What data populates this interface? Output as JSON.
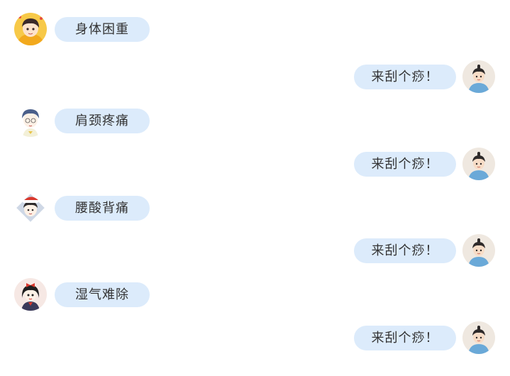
{
  "colors": {
    "bubble_bg": "#dcebfb",
    "text": "#333333",
    "page_bg": "#ffffff"
  },
  "chat": {
    "messages": [
      {
        "side": "left",
        "avatar": "boy-yellow-hoodie-avatar",
        "text": "身体困重"
      },
      {
        "side": "right",
        "avatar": "therapist-avatar",
        "text": "来刮个痧！"
      },
      {
        "side": "left",
        "avatar": "boy-blue-hair-avatar",
        "text": "肩颈疼痛"
      },
      {
        "side": "right",
        "avatar": "therapist-avatar",
        "text": "来刮个痧！"
      },
      {
        "side": "left",
        "avatar": "boy-santa-hat-avatar",
        "text": "腰酸背痛"
      },
      {
        "side": "right",
        "avatar": "therapist-avatar",
        "text": "来刮个痧！"
      },
      {
        "side": "left",
        "avatar": "girl-red-bow-avatar",
        "text": "湿气难除"
      },
      {
        "side": "right",
        "avatar": "therapist-avatar",
        "text": "来刮个痧！"
      }
    ]
  }
}
